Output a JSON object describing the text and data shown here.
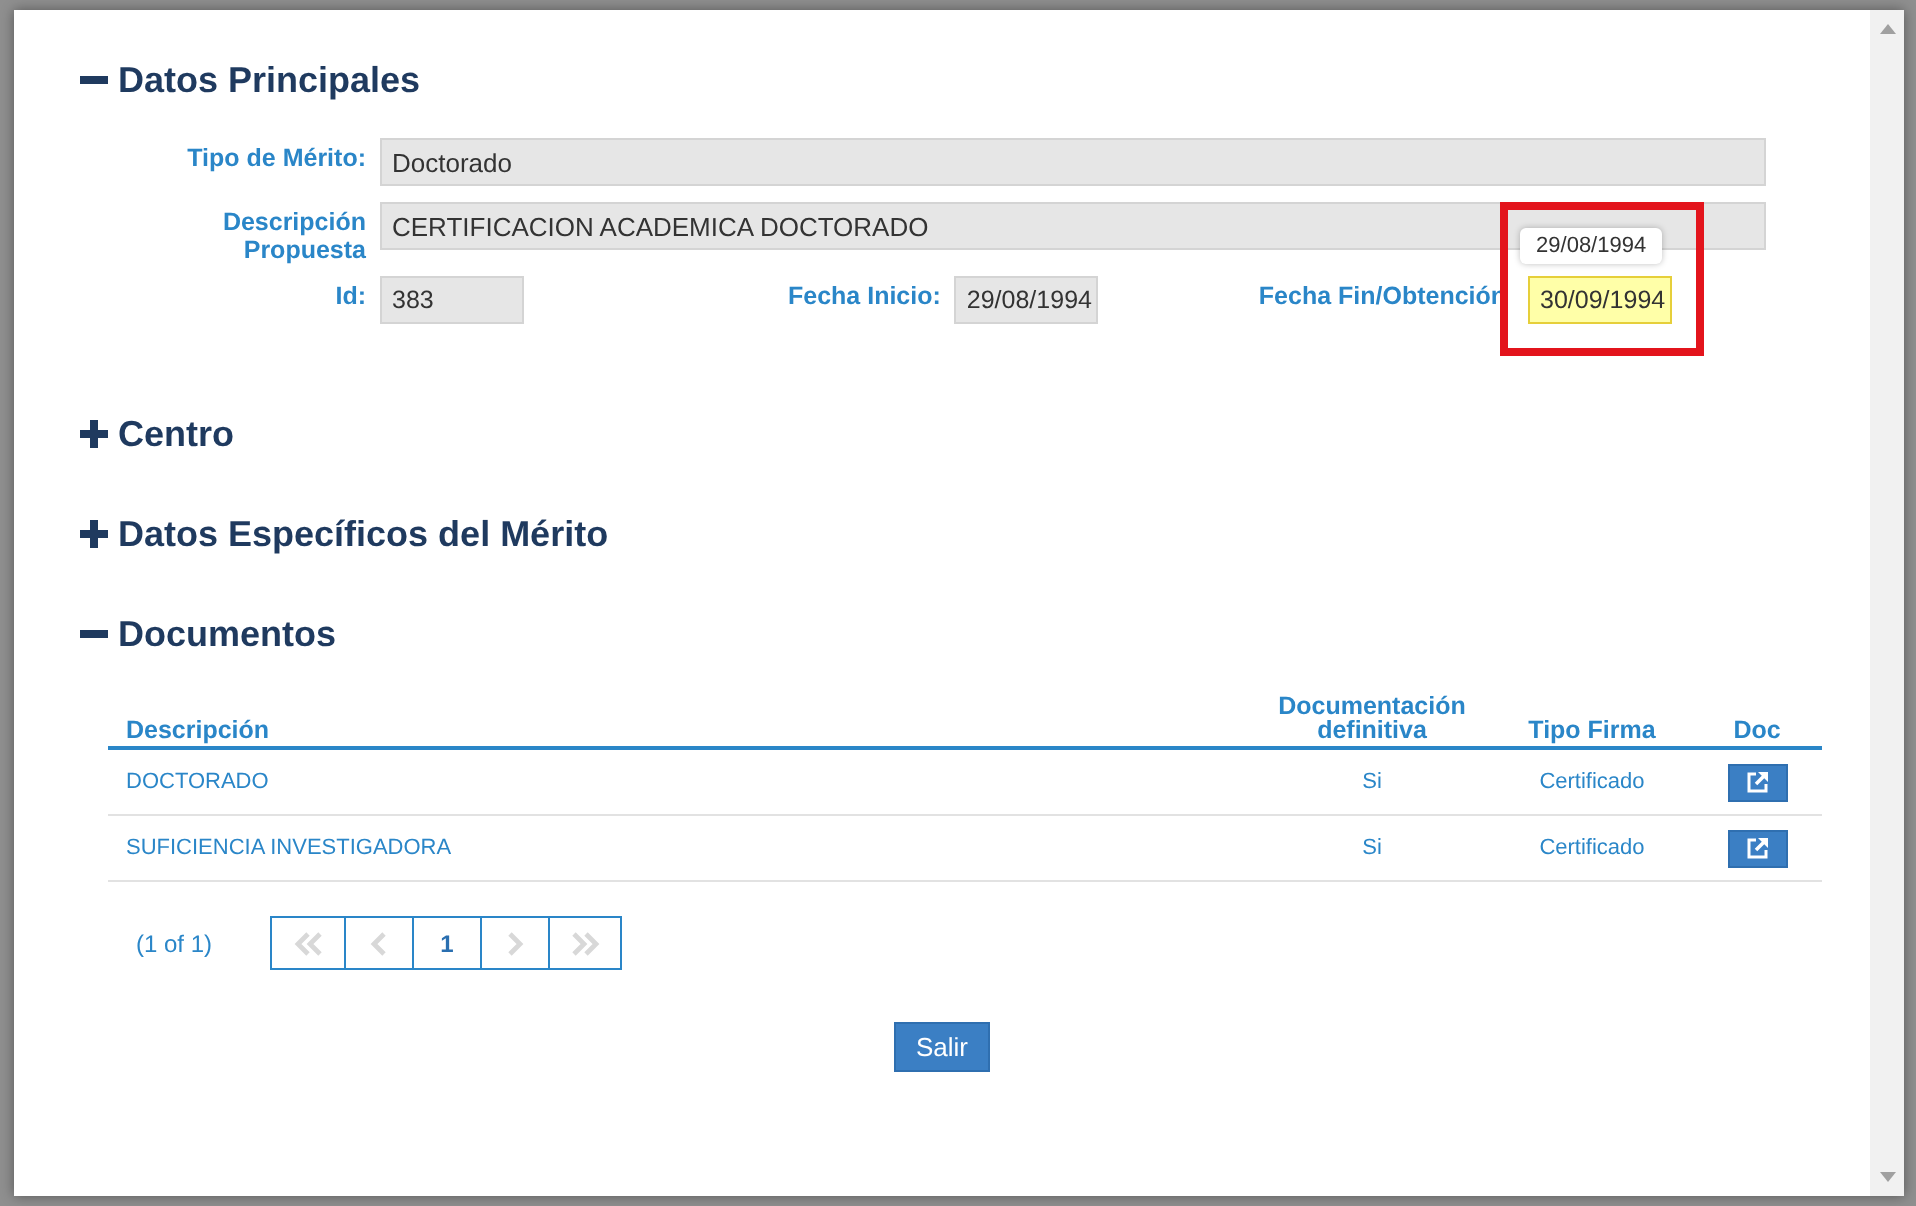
{
  "sections": [
    {
      "title": "Datos Principales",
      "expanded": true,
      "kind": "form",
      "rows": [
        [
          {
            "label": "Tipo de Mérito:",
            "value": "Doctorado"
          }
        ],
        [
          {
            "label": "Descripción Propuesta",
            "value": "CERTIFICACION ACADEMICA DOCTORADO"
          }
        ],
        [
          {
            "label": "Id:",
            "value": "383"
          },
          {
            "label": "Fecha Inicio:",
            "value": "29/08/1994"
          },
          {
            "label": "Fecha Fin/Obtención",
            "value": "30/09/1994",
            "highlighted": true,
            "annotated": true,
            "tooltip": "29/08/1994"
          }
        ]
      ]
    },
    {
      "title": "Centro",
      "expanded": false
    },
    {
      "title": "Datos Específicos del Mérito",
      "expanded": false
    },
    {
      "title": "Documentos",
      "expanded": true,
      "kind": "table",
      "columns": [
        "Descripción",
        "Documentación definitiva",
        "Tipo Firma",
        "Doc"
      ],
      "rows": [
        {
          "descripcion": "DOCTORADO",
          "definitiva": "Si",
          "tipo_firma": "Certificado"
        },
        {
          "descripcion": "SUFICIENCIA INVESTIGADORA",
          "definitiva": "Si",
          "tipo_firma": "Certificado"
        }
      ],
      "pagination": {
        "summary": "(1 of 1)",
        "pages": [
          {
            "label": "1",
            "selected": true
          }
        ],
        "first_disabled": true,
        "prev_disabled": true,
        "next_disabled": true,
        "last_disabled": true
      }
    }
  ],
  "buttons": [
    "Salir"
  ]
}
